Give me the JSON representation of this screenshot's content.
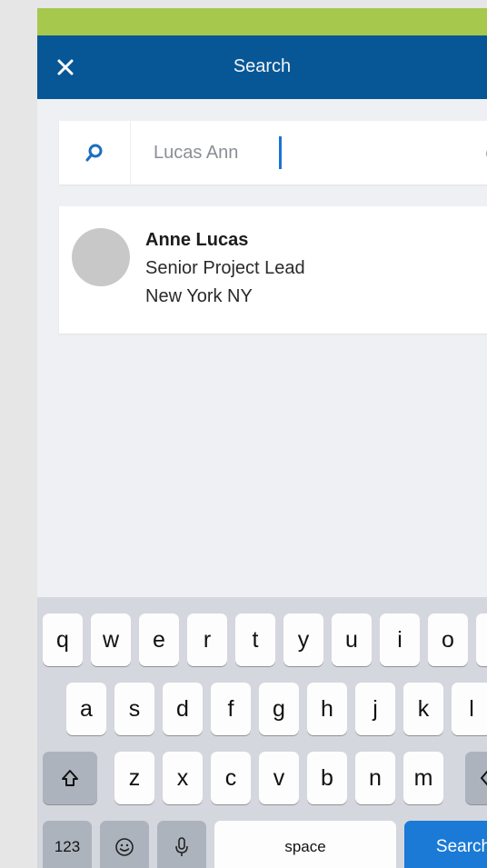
{
  "nav": {
    "title": "Search"
  },
  "search": {
    "value": "Lucas Ann"
  },
  "result": {
    "name": "Anne Lucas",
    "title": "Senior Project Lead",
    "location": "New York NY"
  },
  "keyboard": {
    "row1": [
      "q",
      "w",
      "e",
      "r",
      "t",
      "y",
      "u",
      "i",
      "o"
    ],
    "row2": [
      "a",
      "s",
      "d",
      "f",
      "g",
      "h",
      "j",
      "k",
      "l"
    ],
    "row3": [
      "z",
      "x",
      "c",
      "v",
      "b",
      "n",
      "m"
    ],
    "numbers_label": "123",
    "space_label": "space",
    "search_label": "Search"
  },
  "colors": {
    "status_bar": "#a6c94d",
    "nav_bar": "#075796",
    "accent": "#1a7ad6"
  }
}
